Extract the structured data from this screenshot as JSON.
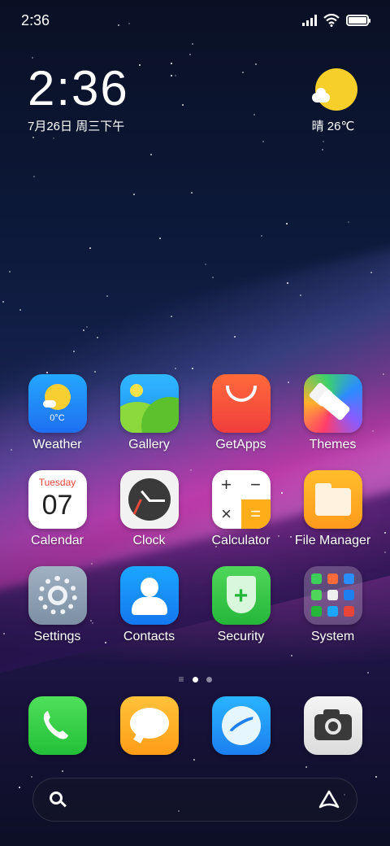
{
  "status_bar": {
    "time": "2:36",
    "signal_icon": "signal-icon",
    "wifi_icon": "wifi-icon",
    "battery_icon": "battery-icon"
  },
  "clock_widget": {
    "time": "2:36",
    "date": "7月26日 周三下午"
  },
  "weather_widget": {
    "condition_temp": "晴 26℃",
    "icon": "sun-cloud-icon"
  },
  "apps": [
    {
      "label": "Weather",
      "icon": "weather-icon",
      "inner": "0°C"
    },
    {
      "label": "Gallery",
      "icon": "gallery-icon"
    },
    {
      "label": "GetApps",
      "icon": "getapps-icon"
    },
    {
      "label": "Themes",
      "icon": "themes-icon"
    },
    {
      "label": "Calendar",
      "icon": "calendar-icon",
      "day": "Tuesday",
      "num": "07"
    },
    {
      "label": "Clock",
      "icon": "clock-icon"
    },
    {
      "label": "Calculator",
      "icon": "calculator-icon",
      "keys": [
        "+",
        "−",
        "×",
        "="
      ]
    },
    {
      "label": "File Manager",
      "icon": "folder-icon"
    },
    {
      "label": "Settings",
      "icon": "gear-icon"
    },
    {
      "label": "Contacts",
      "icon": "contacts-icon"
    },
    {
      "label": "Security",
      "icon": "shield-icon",
      "symbol": "+"
    },
    {
      "label": "System",
      "icon": "folder-grid-icon"
    }
  ],
  "page_indicator": {
    "menu_glyph": "≡",
    "pages": 2,
    "active": 1
  },
  "dock": [
    {
      "icon": "phone-icon"
    },
    {
      "icon": "message-icon"
    },
    {
      "icon": "browser-icon"
    },
    {
      "icon": "camera-icon"
    }
  ],
  "search_bar": {
    "search_icon": "search-icon",
    "assistant_icon": "assistant-icon"
  },
  "colors": {
    "accent_sun": "#f6cf2b",
    "calendar_red": "#e8443a",
    "wallpaper_pink": "#ff46c8"
  }
}
